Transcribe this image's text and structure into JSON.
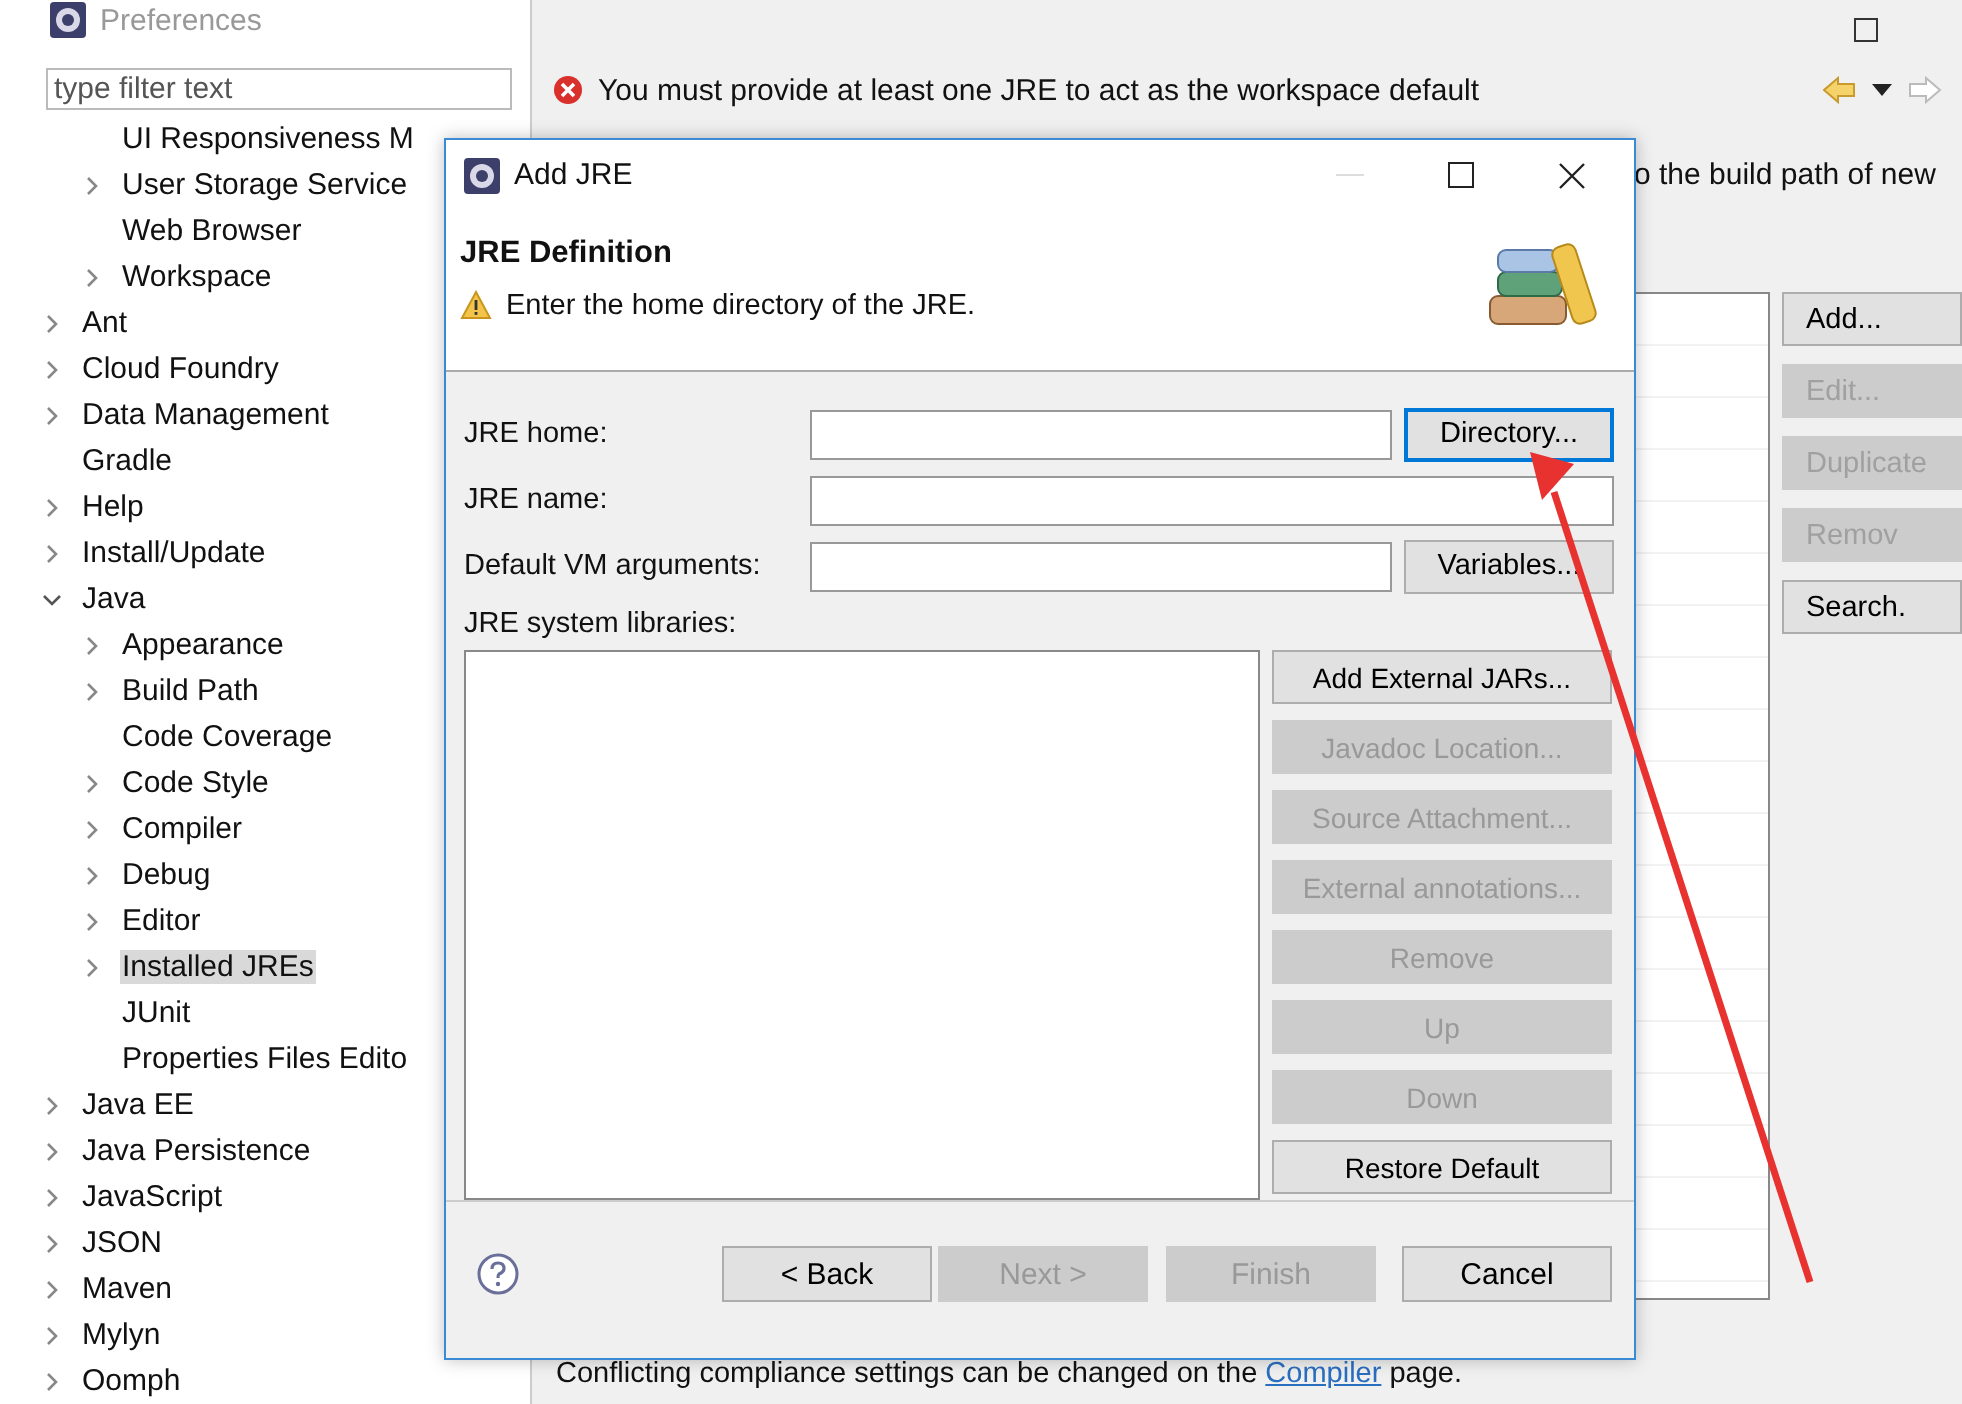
{
  "window": {
    "title": "Preferences"
  },
  "filter": {
    "placeholder": "type filter text"
  },
  "tree": {
    "continued_children": [
      {
        "label": "UI Responsiveness M",
        "has_children": false,
        "selected": false
      },
      {
        "label": "User Storage Service",
        "has_children": true,
        "expanded": false,
        "selected": false
      },
      {
        "label": "Web Browser",
        "has_children": false,
        "selected": false
      },
      {
        "label": "Workspace",
        "has_children": true,
        "expanded": false,
        "selected": false
      }
    ],
    "items": [
      {
        "label": "Ant",
        "has_children": true,
        "expanded": false,
        "selected": false
      },
      {
        "label": "Cloud Foundry",
        "has_children": true,
        "expanded": false,
        "selected": false
      },
      {
        "label": "Data Management",
        "has_children": true,
        "expanded": false,
        "selected": false
      },
      {
        "label": "Gradle",
        "has_children": false,
        "selected": false
      },
      {
        "label": "Help",
        "has_children": true,
        "expanded": false,
        "selected": false
      },
      {
        "label": "Install/Update",
        "has_children": true,
        "expanded": false,
        "selected": false
      },
      {
        "label": "Java",
        "has_children": true,
        "expanded": true,
        "selected": false,
        "children": [
          {
            "label": "Appearance",
            "has_children": true,
            "expanded": false,
            "selected": false
          },
          {
            "label": "Build Path",
            "has_children": true,
            "expanded": false,
            "selected": false
          },
          {
            "label": "Code Coverage",
            "has_children": false,
            "selected": false
          },
          {
            "label": "Code Style",
            "has_children": true,
            "expanded": false,
            "selected": false
          },
          {
            "label": "Compiler",
            "has_children": true,
            "expanded": false,
            "selected": false
          },
          {
            "label": "Debug",
            "has_children": true,
            "expanded": false,
            "selected": false
          },
          {
            "label": "Editor",
            "has_children": true,
            "expanded": false,
            "selected": false
          },
          {
            "label": "Installed JREs",
            "has_children": true,
            "expanded": false,
            "selected": true
          },
          {
            "label": "JUnit",
            "has_children": false,
            "selected": false
          },
          {
            "label": "Properties Files Edito",
            "has_children": false,
            "selected": false
          }
        ]
      },
      {
        "label": "Java EE",
        "has_children": true,
        "expanded": false,
        "selected": false
      },
      {
        "label": "Java Persistence",
        "has_children": true,
        "expanded": false,
        "selected": false
      },
      {
        "label": "JavaScript",
        "has_children": true,
        "expanded": false,
        "selected": false
      },
      {
        "label": "JSON",
        "has_children": true,
        "expanded": false,
        "selected": false
      },
      {
        "label": "Maven",
        "has_children": true,
        "expanded": false,
        "selected": false
      },
      {
        "label": "Mylyn",
        "has_children": true,
        "expanded": false,
        "selected": false
      },
      {
        "label": "Oomph",
        "has_children": true,
        "expanded": false,
        "selected": false
      }
    ]
  },
  "page": {
    "error_message": "You must provide at least one JRE to act as the workspace default",
    "description": "o the build path of new",
    "side_buttons": [
      {
        "label": "Add...",
        "disabled": false
      },
      {
        "label": "Edit...",
        "disabled": true
      },
      {
        "label": "Duplicate",
        "disabled": true
      },
      {
        "label": "Remov",
        "disabled": true
      },
      {
        "label": "Search.",
        "disabled": false
      }
    ],
    "footer": {
      "before": "Conflicting compliance settings can be changed on the ",
      "link": "Compiler",
      "after": " page."
    }
  },
  "dialog": {
    "title": "Add JRE",
    "heading": "JRE Definition",
    "message": "Enter the home directory of the JRE.",
    "fields": [
      {
        "label": "JRE home:",
        "button": "Directory...",
        "focused": true
      },
      {
        "label": "JRE name:"
      },
      {
        "label": "Default VM arguments:",
        "button": "Variables...",
        "focused": false
      }
    ],
    "libraries_label": "JRE system libraries:",
    "library_buttons": [
      {
        "label": "Add External JARs...",
        "disabled": false
      },
      {
        "label": "Javadoc Location...",
        "disabled": true
      },
      {
        "label": "Source Attachment...",
        "disabled": true
      },
      {
        "label": "External annotations...",
        "disabled": true
      },
      {
        "label": "Remove",
        "disabled": true
      },
      {
        "label": "Up",
        "disabled": true
      },
      {
        "label": "Down",
        "disabled": true
      },
      {
        "label": "Restore Default",
        "disabled": false
      }
    ],
    "wizard_buttons": [
      {
        "label": "< Back",
        "disabled": false
      },
      {
        "label": "Next >",
        "disabled": true
      },
      {
        "label": "Finish",
        "disabled": true
      },
      {
        "label": "Cancel",
        "disabled": false
      }
    ]
  }
}
